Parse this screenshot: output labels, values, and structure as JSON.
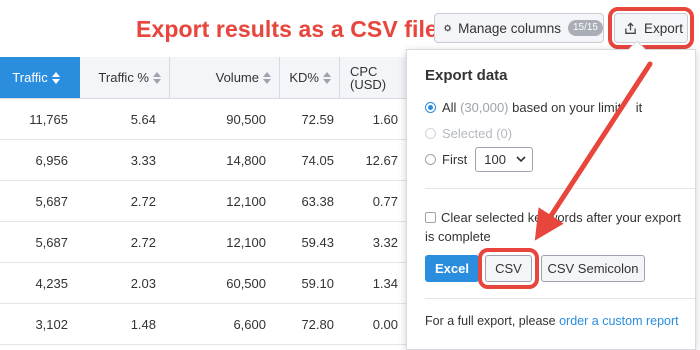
{
  "annotation": {
    "title": "Export results as a CSV file",
    "color": "#e8453c"
  },
  "toolbar": {
    "manage_columns_label": "Manage columns",
    "manage_columns_count": "15/15",
    "export_label": "Export"
  },
  "table": {
    "columns": [
      "Traffic",
      "Traffic %",
      "Volume",
      "KD%",
      "CPC (USD)"
    ],
    "cpc_line1": "CPC",
    "cpc_line2": "(USD)",
    "sorted_column": "Traffic",
    "rows": [
      [
        "11,765",
        "5.64",
        "90,500",
        "72.59",
        "1.60"
      ],
      [
        "6,956",
        "3.33",
        "14,800",
        "74.05",
        "12.67"
      ],
      [
        "5,687",
        "2.72",
        "12,100",
        "63.38",
        "0.77"
      ],
      [
        "5,687",
        "2.72",
        "12,100",
        "59.43",
        "3.32"
      ],
      [
        "4,235",
        "2.03",
        "60,500",
        "59.10",
        "1.34"
      ],
      [
        "3,102",
        "1.48",
        "6,600",
        "72.80",
        "0.00"
      ]
    ]
  },
  "export_panel": {
    "title": "Export data",
    "option_all_label": "All",
    "option_all_count": "(30,000)",
    "option_all_note": "based on your limit",
    "option_all_tail": "it",
    "option_selected_label": "Selected",
    "option_selected_count": "(0)",
    "option_first_label": "First",
    "first_value": "100",
    "clear_checkbox_label": "Clear selected keywords after your export is complete",
    "buttons": [
      "Excel",
      "CSV",
      "CSV Semicolon"
    ],
    "footer_text": "For a full export, please",
    "footer_link": "order a custom report",
    "selected_option": "All"
  },
  "colors": {
    "accent_blue": "#2b8dde",
    "annotation_red": "#e8453c"
  }
}
